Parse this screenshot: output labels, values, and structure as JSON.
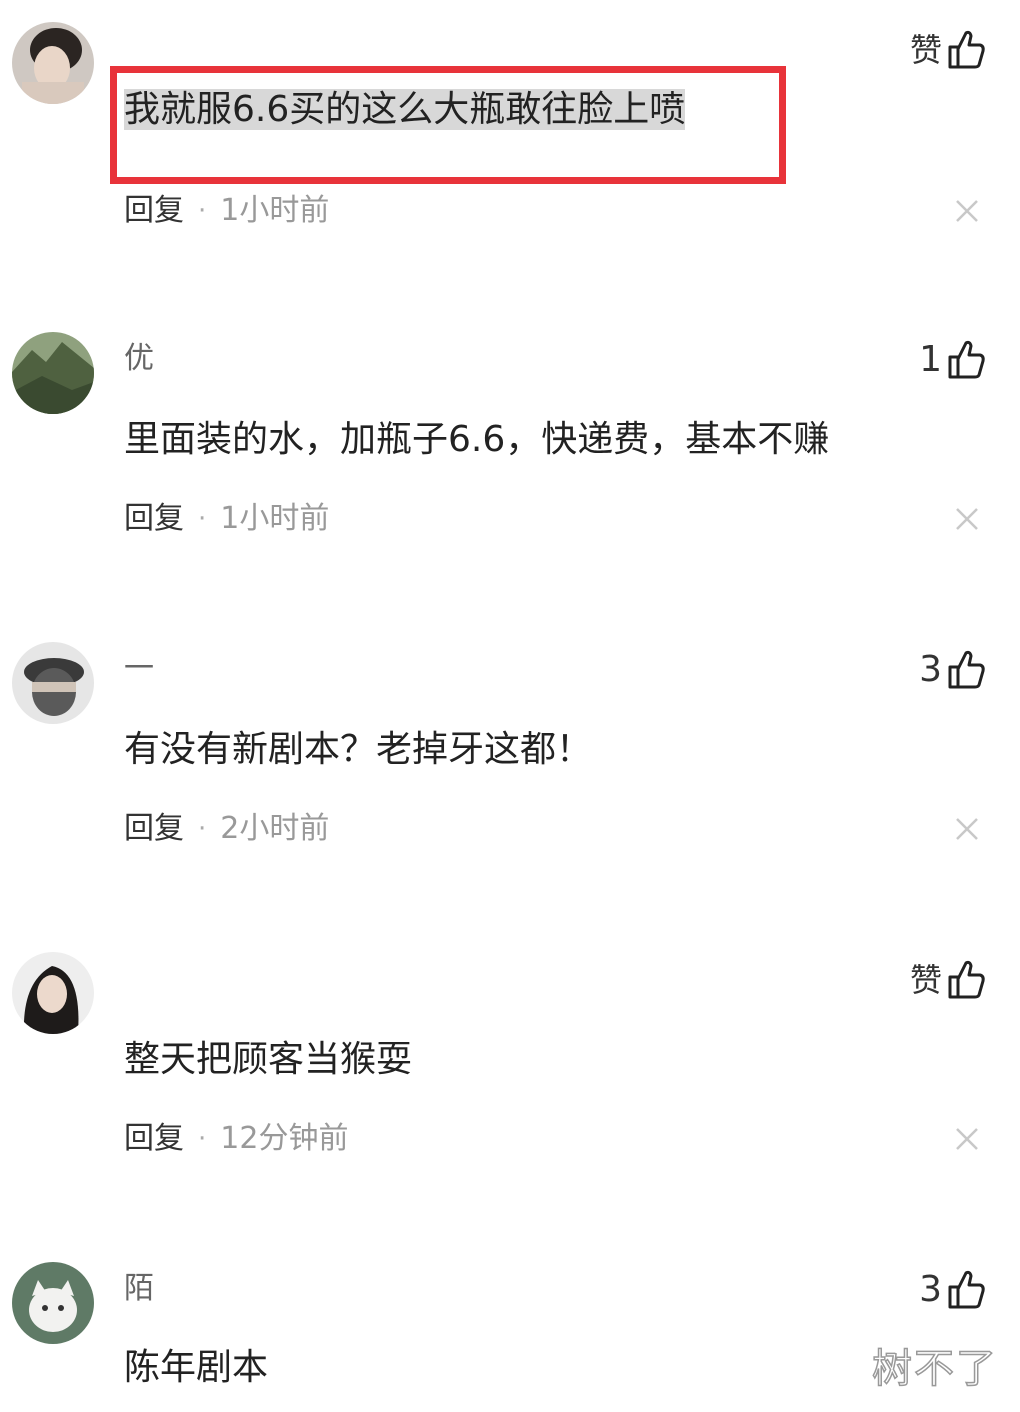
{
  "comments": [
    {
      "username_prefix": "",
      "content": "我就服6.6买的这么大瓶敢往脸上喷",
      "reply": "回复",
      "separator": "·",
      "time": "1小时前",
      "likes": "赞",
      "highlighted": true
    },
    {
      "username_prefix": "优",
      "content": "里面装的水，加瓶子6.6，快递费，基本不赚",
      "reply": "回复",
      "separator": "·",
      "time": "1小时前",
      "likes": "1"
    },
    {
      "username_prefix": "一",
      "content": "有没有新剧本？老掉牙这都！",
      "reply": "回复",
      "separator": "·",
      "time": "2小时前",
      "likes": "3"
    },
    {
      "username_prefix": "",
      "content": "整天把顾客当猴耍",
      "reply": "回复",
      "separator": "·",
      "time": "12分钟前",
      "likes": "赞"
    },
    {
      "username_prefix": "陌",
      "content": "陈年剧本",
      "likes": "3"
    }
  ],
  "watermark": "树不了",
  "icons": {
    "like": "thumbs-up-icon",
    "close": "close-icon"
  },
  "colors": {
    "highlight_box": "#e8333a",
    "text_selection": "#d8d8d8"
  }
}
